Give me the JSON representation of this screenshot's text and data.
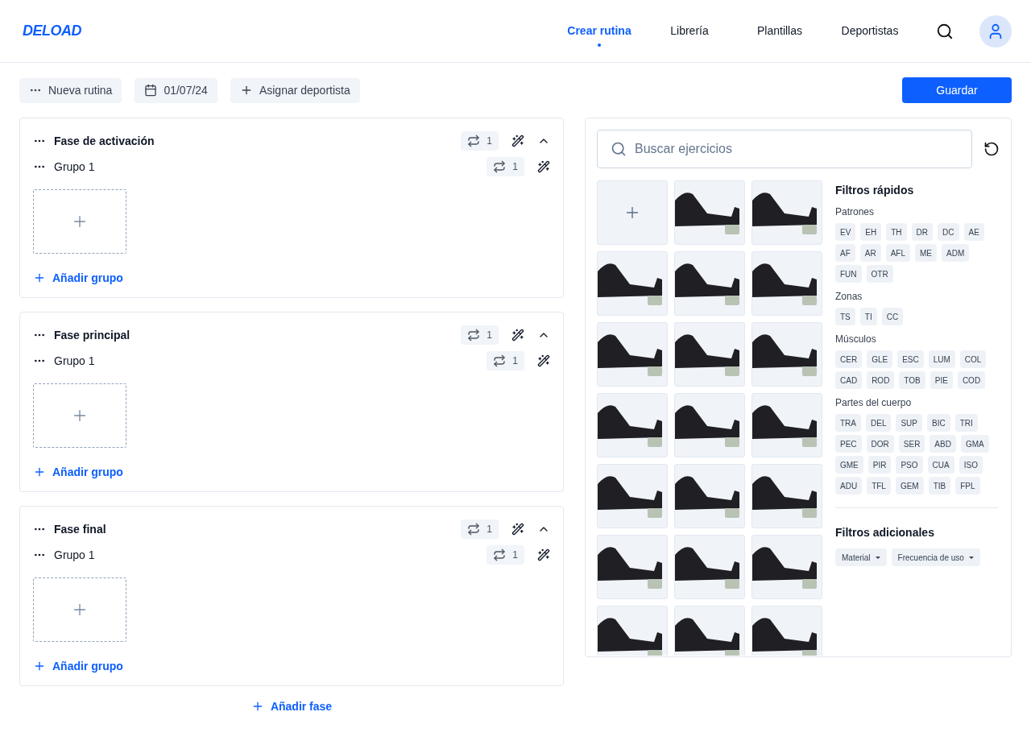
{
  "brand": "DELOAD",
  "nav": [
    {
      "label": "Crear rutina",
      "selected": true
    },
    {
      "label": "Librería",
      "selected": false
    },
    {
      "label": "Plantillas",
      "selected": false
    },
    {
      "label": "Deportistas",
      "selected": false
    }
  ],
  "toolbar": {
    "routine_name": "Nueva rutina",
    "date": "01/07/24",
    "assign": "Asignar deportista",
    "save": "Guardar"
  },
  "phases": [
    {
      "title": "Fase de activación",
      "repeat": "1",
      "expanded": true,
      "groups": [
        {
          "title": "Grupo 1",
          "repeat": "1"
        }
      ],
      "add_group": "Añadir grupo"
    },
    {
      "title": "Fase principal",
      "repeat": "1",
      "expanded": true,
      "groups": [
        {
          "title": "Grupo 1",
          "repeat": "1"
        }
      ],
      "add_group": "Añadir grupo"
    },
    {
      "title": "Fase final",
      "repeat": "1",
      "expanded": true,
      "groups": [
        {
          "title": "Grupo 1",
          "repeat": "1"
        }
      ],
      "add_group": "Añadir grupo"
    }
  ],
  "add_phase": "Añadir fase",
  "library": {
    "search": {
      "placeholder": "Buscar ejercicios"
    },
    "quick_filters_title": "Filtros rápidos",
    "filter_groups": [
      {
        "title": "Patrones",
        "chips": [
          "EV",
          "EH",
          "TH",
          "DR",
          "DC",
          "AE",
          "AF",
          "AR",
          "AFL",
          "ME",
          "ADM",
          "FUN",
          "OTR"
        ]
      },
      {
        "title": "Zonas",
        "chips": [
          "TS",
          "TI",
          "CC"
        ]
      },
      {
        "title": "Músculos",
        "chips": [
          "CER",
          "GLE",
          "ESC",
          "LUM",
          "COL",
          "CAD",
          "ROD",
          "TOB",
          "PIE",
          "COD"
        ]
      },
      {
        "title": "Partes del cuerpo",
        "chips": [
          "TRA",
          "DEL",
          "SUP",
          "BIC",
          "TRI",
          "PEC",
          "DOR",
          "SER",
          "ABD",
          "GMA",
          "GME",
          "PIR",
          "PSO",
          "CUA",
          "ISO",
          "ADU",
          "TFL",
          "GEM",
          "TIB",
          "FPL"
        ]
      }
    ],
    "additional_title": "Filtros adicionales",
    "dropdowns": [
      "Material",
      "Frecuencia de uso"
    ]
  }
}
